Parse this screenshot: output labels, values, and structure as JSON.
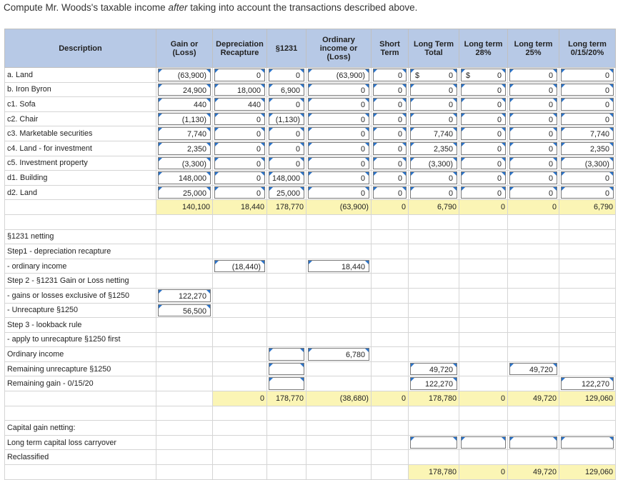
{
  "prompt": {
    "before": "Compute Mr. Woods's taxable income ",
    "emph": "after",
    "after": " taking into account the transactions described above."
  },
  "headers": [
    "Description",
    "Gain or (Loss)",
    "Depreciation Recapture",
    "§1231",
    "Ordinary income or (Loss)",
    "Short Term",
    "Long Term Total",
    "Long term 28%",
    "Long term 25%",
    "Long term 0/15/20%"
  ],
  "rows": [
    {
      "label": "a. Land",
      "cells": [
        {
          "t": "i",
          "v": "(63,900)"
        },
        {
          "t": "i",
          "v": "0"
        },
        {
          "t": "i",
          "v": "0"
        },
        {
          "t": "i",
          "v": "(63,900)"
        },
        {
          "t": "i",
          "v": "0"
        },
        {
          "t": "i",
          "v": "0",
          "c": "$"
        },
        {
          "t": "i",
          "v": "0",
          "c": "$"
        },
        {
          "t": "i",
          "v": "0"
        },
        {
          "t": "i",
          "v": "0"
        }
      ]
    },
    {
      "label": "b. Iron Byron",
      "cells": [
        {
          "t": "i",
          "v": "24,900"
        },
        {
          "t": "i",
          "v": "18,000"
        },
        {
          "t": "i",
          "v": "6,900"
        },
        {
          "t": "i",
          "v": "0"
        },
        {
          "t": "i",
          "v": "0"
        },
        {
          "t": "i",
          "v": "0"
        },
        {
          "t": "i",
          "v": "0"
        },
        {
          "t": "i",
          "v": "0"
        },
        {
          "t": "i",
          "v": "0"
        }
      ]
    },
    {
      "label": "c1. Sofa",
      "cells": [
        {
          "t": "i",
          "v": "440"
        },
        {
          "t": "i",
          "v": "440"
        },
        {
          "t": "i",
          "v": "0"
        },
        {
          "t": "i",
          "v": "0"
        },
        {
          "t": "i",
          "v": "0"
        },
        {
          "t": "i",
          "v": "0"
        },
        {
          "t": "i",
          "v": "0"
        },
        {
          "t": "i",
          "v": "0"
        },
        {
          "t": "i",
          "v": "0"
        }
      ]
    },
    {
      "label": "c2. Chair",
      "cells": [
        {
          "t": "i",
          "v": "(1,130)"
        },
        {
          "t": "i",
          "v": "0"
        },
        {
          "t": "i",
          "v": "(1,130)"
        },
        {
          "t": "i",
          "v": "0"
        },
        {
          "t": "i",
          "v": "0"
        },
        {
          "t": "i",
          "v": "0"
        },
        {
          "t": "i",
          "v": "0"
        },
        {
          "t": "i",
          "v": "0"
        },
        {
          "t": "i",
          "v": "0"
        }
      ]
    },
    {
      "label": "c3. Marketable securities",
      "cells": [
        {
          "t": "i",
          "v": "7,740"
        },
        {
          "t": "i",
          "v": "0"
        },
        {
          "t": "i",
          "v": "0"
        },
        {
          "t": "i",
          "v": "0"
        },
        {
          "t": "i",
          "v": "0"
        },
        {
          "t": "i",
          "v": "7,740"
        },
        {
          "t": "i",
          "v": "0"
        },
        {
          "t": "i",
          "v": "0"
        },
        {
          "t": "i",
          "v": "7,740"
        }
      ]
    },
    {
      "label": "c4. Land - for investment",
      "cells": [
        {
          "t": "i",
          "v": "2,350"
        },
        {
          "t": "i",
          "v": "0"
        },
        {
          "t": "i",
          "v": "0"
        },
        {
          "t": "i",
          "v": "0"
        },
        {
          "t": "i",
          "v": "0"
        },
        {
          "t": "i",
          "v": "2,350"
        },
        {
          "t": "i",
          "v": "0"
        },
        {
          "t": "i",
          "v": "0"
        },
        {
          "t": "i",
          "v": "2,350"
        }
      ]
    },
    {
      "label": "c5. Investment property",
      "cells": [
        {
          "t": "i",
          "v": "(3,300)"
        },
        {
          "t": "i",
          "v": "0"
        },
        {
          "t": "i",
          "v": "0"
        },
        {
          "t": "i",
          "v": "0"
        },
        {
          "t": "i",
          "v": "0"
        },
        {
          "t": "i",
          "v": "(3,300)"
        },
        {
          "t": "i",
          "v": "0"
        },
        {
          "t": "i",
          "v": "0"
        },
        {
          "t": "i",
          "v": "(3,300)"
        }
      ]
    },
    {
      "label": "d1. Building",
      "cells": [
        {
          "t": "i",
          "v": "148,000"
        },
        {
          "t": "i",
          "v": "0"
        },
        {
          "t": "i",
          "v": "148,000"
        },
        {
          "t": "i",
          "v": "0"
        },
        {
          "t": "i",
          "v": "0"
        },
        {
          "t": "i",
          "v": "0"
        },
        {
          "t": "i",
          "v": "0"
        },
        {
          "t": "i",
          "v": "0"
        },
        {
          "t": "i",
          "v": "0"
        }
      ]
    },
    {
      "label": "d2. Land",
      "cells": [
        {
          "t": "i",
          "v": "25,000"
        },
        {
          "t": "i",
          "v": "0"
        },
        {
          "t": "i",
          "v": "25,000"
        },
        {
          "t": "i",
          "v": "0"
        },
        {
          "t": "i",
          "v": "0"
        },
        {
          "t": "i",
          "v": "0"
        },
        {
          "t": "i",
          "v": "0"
        },
        {
          "t": "i",
          "v": "0"
        },
        {
          "t": "i",
          "v": "0"
        }
      ]
    },
    {
      "label": "",
      "cells": [
        {
          "t": "y",
          "v": "140,100"
        },
        {
          "t": "y",
          "v": "18,440"
        },
        {
          "t": "y",
          "v": "178,770"
        },
        {
          "t": "y",
          "v": "(63,900)"
        },
        {
          "t": "y",
          "v": "0"
        },
        {
          "t": "y",
          "v": "6,790"
        },
        {
          "t": "y",
          "v": "0"
        },
        {
          "t": "y",
          "v": "0"
        },
        {
          "t": "y",
          "v": "6,790"
        }
      ]
    },
    {
      "label": "",
      "cells": [
        {
          "t": "r",
          "v": ""
        },
        {
          "t": "r",
          "v": ""
        },
        {
          "t": "r",
          "v": ""
        },
        {
          "t": "r",
          "v": ""
        },
        {
          "t": "r",
          "v": ""
        },
        {
          "t": "r",
          "v": ""
        },
        {
          "t": "r",
          "v": ""
        },
        {
          "t": "r",
          "v": ""
        },
        {
          "t": "r",
          "v": ""
        }
      ]
    },
    {
      "label": "§1231 netting",
      "cells": [
        {
          "t": "r",
          "v": ""
        },
        {
          "t": "r",
          "v": ""
        },
        {
          "t": "r",
          "v": ""
        },
        {
          "t": "r",
          "v": ""
        },
        {
          "t": "r",
          "v": ""
        },
        {
          "t": "r",
          "v": ""
        },
        {
          "t": "r",
          "v": ""
        },
        {
          "t": "r",
          "v": ""
        },
        {
          "t": "r",
          "v": ""
        }
      ]
    },
    {
      "label": "Step1 - depreciation recapture",
      "cells": [
        {
          "t": "r",
          "v": ""
        },
        {
          "t": "r",
          "v": ""
        },
        {
          "t": "r",
          "v": ""
        },
        {
          "t": "r",
          "v": ""
        },
        {
          "t": "r",
          "v": ""
        },
        {
          "t": "r",
          "v": ""
        },
        {
          "t": "r",
          "v": ""
        },
        {
          "t": "r",
          "v": ""
        },
        {
          "t": "r",
          "v": ""
        }
      ]
    },
    {
      "label": "- ordinary income",
      "cells": [
        {
          "t": "r",
          "v": ""
        },
        {
          "t": "i",
          "v": "(18,440)"
        },
        {
          "t": "r",
          "v": ""
        },
        {
          "t": "i",
          "v": "18,440"
        },
        {
          "t": "r",
          "v": ""
        },
        {
          "t": "r",
          "v": ""
        },
        {
          "t": "r",
          "v": ""
        },
        {
          "t": "r",
          "v": ""
        },
        {
          "t": "r",
          "v": ""
        }
      ]
    },
    {
      "label": "Step 2 - §1231 Gain or Loss netting",
      "cells": [
        {
          "t": "r",
          "v": ""
        },
        {
          "t": "r",
          "v": ""
        },
        {
          "t": "r",
          "v": ""
        },
        {
          "t": "r",
          "v": ""
        },
        {
          "t": "r",
          "v": ""
        },
        {
          "t": "r",
          "v": ""
        },
        {
          "t": "r",
          "v": ""
        },
        {
          "t": "r",
          "v": ""
        },
        {
          "t": "r",
          "v": ""
        }
      ]
    },
    {
      "label": "- gains or losses exclusive of §1250",
      "cells": [
        {
          "t": "i",
          "v": "122,270"
        },
        {
          "t": "r",
          "v": ""
        },
        {
          "t": "r",
          "v": ""
        },
        {
          "t": "r",
          "v": ""
        },
        {
          "t": "r",
          "v": ""
        },
        {
          "t": "r",
          "v": ""
        },
        {
          "t": "r",
          "v": ""
        },
        {
          "t": "r",
          "v": ""
        },
        {
          "t": "r",
          "v": ""
        }
      ]
    },
    {
      "label": "- Unrecapture §1250",
      "cells": [
        {
          "t": "i",
          "v": "56,500"
        },
        {
          "t": "r",
          "v": ""
        },
        {
          "t": "r",
          "v": ""
        },
        {
          "t": "r",
          "v": ""
        },
        {
          "t": "r",
          "v": ""
        },
        {
          "t": "r",
          "v": ""
        },
        {
          "t": "r",
          "v": ""
        },
        {
          "t": "r",
          "v": ""
        },
        {
          "t": "r",
          "v": ""
        }
      ]
    },
    {
      "label": "Step 3 - lookback rule",
      "cells": [
        {
          "t": "r",
          "v": ""
        },
        {
          "t": "r",
          "v": ""
        },
        {
          "t": "r",
          "v": ""
        },
        {
          "t": "r",
          "v": ""
        },
        {
          "t": "r",
          "v": ""
        },
        {
          "t": "r",
          "v": ""
        },
        {
          "t": "r",
          "v": ""
        },
        {
          "t": "r",
          "v": ""
        },
        {
          "t": "r",
          "v": ""
        }
      ]
    },
    {
      "label": "- apply to unrecapture §1250 first",
      "cells": [
        {
          "t": "r",
          "v": ""
        },
        {
          "t": "r",
          "v": ""
        },
        {
          "t": "r",
          "v": ""
        },
        {
          "t": "r",
          "v": ""
        },
        {
          "t": "r",
          "v": ""
        },
        {
          "t": "r",
          "v": ""
        },
        {
          "t": "r",
          "v": ""
        },
        {
          "t": "r",
          "v": ""
        },
        {
          "t": "r",
          "v": ""
        }
      ]
    },
    {
      "label": "Ordinary income",
      "cells": [
        {
          "t": "r",
          "v": ""
        },
        {
          "t": "r",
          "v": ""
        },
        {
          "t": "i",
          "v": ""
        },
        {
          "t": "i",
          "v": "6,780"
        },
        {
          "t": "r",
          "v": ""
        },
        {
          "t": "r",
          "v": ""
        },
        {
          "t": "r",
          "v": ""
        },
        {
          "t": "r",
          "v": ""
        },
        {
          "t": "r",
          "v": ""
        }
      ]
    },
    {
      "label": "Remaining unrecapture §1250",
      "cells": [
        {
          "t": "r",
          "v": ""
        },
        {
          "t": "r",
          "v": ""
        },
        {
          "t": "i",
          "v": ""
        },
        {
          "t": "r",
          "v": ""
        },
        {
          "t": "r",
          "v": ""
        },
        {
          "t": "i",
          "v": "49,720"
        },
        {
          "t": "r",
          "v": ""
        },
        {
          "t": "i",
          "v": "49,720"
        },
        {
          "t": "r",
          "v": ""
        }
      ]
    },
    {
      "label": "Remaining gain - 0/15/20",
      "cells": [
        {
          "t": "r",
          "v": ""
        },
        {
          "t": "r",
          "v": ""
        },
        {
          "t": "i",
          "v": ""
        },
        {
          "t": "r",
          "v": ""
        },
        {
          "t": "r",
          "v": ""
        },
        {
          "t": "i",
          "v": "122,270"
        },
        {
          "t": "r",
          "v": ""
        },
        {
          "t": "r",
          "v": ""
        },
        {
          "t": "i",
          "v": "122,270"
        }
      ]
    },
    {
      "label": "",
      "cells": [
        {
          "t": "r",
          "v": ""
        },
        {
          "t": "y",
          "v": "0"
        },
        {
          "t": "y",
          "v": "178,770"
        },
        {
          "t": "y",
          "v": "(38,680)"
        },
        {
          "t": "y",
          "v": "0"
        },
        {
          "t": "y",
          "v": "178,780"
        },
        {
          "t": "y",
          "v": "0"
        },
        {
          "t": "y",
          "v": "49,720"
        },
        {
          "t": "y",
          "v": "129,060"
        }
      ]
    },
    {
      "label": "",
      "cells": [
        {
          "t": "r",
          "v": ""
        },
        {
          "t": "r",
          "v": ""
        },
        {
          "t": "r",
          "v": ""
        },
        {
          "t": "r",
          "v": ""
        },
        {
          "t": "r",
          "v": ""
        },
        {
          "t": "r",
          "v": ""
        },
        {
          "t": "r",
          "v": ""
        },
        {
          "t": "r",
          "v": ""
        },
        {
          "t": "r",
          "v": ""
        }
      ]
    },
    {
      "label": "Capital gain netting:",
      "cells": [
        {
          "t": "r",
          "v": ""
        },
        {
          "t": "r",
          "v": ""
        },
        {
          "t": "r",
          "v": ""
        },
        {
          "t": "r",
          "v": ""
        },
        {
          "t": "r",
          "v": ""
        },
        {
          "t": "r",
          "v": ""
        },
        {
          "t": "r",
          "v": ""
        },
        {
          "t": "r",
          "v": ""
        },
        {
          "t": "r",
          "v": ""
        }
      ]
    },
    {
      "label": "Long term capital loss carryover",
      "cells": [
        {
          "t": "r",
          "v": ""
        },
        {
          "t": "r",
          "v": ""
        },
        {
          "t": "r",
          "v": ""
        },
        {
          "t": "r",
          "v": ""
        },
        {
          "t": "r",
          "v": ""
        },
        {
          "t": "i",
          "v": ""
        },
        {
          "t": "i",
          "v": ""
        },
        {
          "t": "i",
          "v": ""
        },
        {
          "t": "i",
          "v": ""
        }
      ]
    },
    {
      "label": "Reclassified",
      "cells": [
        {
          "t": "r",
          "v": ""
        },
        {
          "t": "r",
          "v": ""
        },
        {
          "t": "r",
          "v": ""
        },
        {
          "t": "r",
          "v": ""
        },
        {
          "t": "r",
          "v": ""
        },
        {
          "t": "r",
          "v": ""
        },
        {
          "t": "r",
          "v": ""
        },
        {
          "t": "r",
          "v": ""
        },
        {
          "t": "r",
          "v": ""
        }
      ]
    },
    {
      "label": "",
      "cells": [
        {
          "t": "r",
          "v": ""
        },
        {
          "t": "r",
          "v": ""
        },
        {
          "t": "r",
          "v": ""
        },
        {
          "t": "r",
          "v": ""
        },
        {
          "t": "r",
          "v": ""
        },
        {
          "t": "y",
          "v": "178,780"
        },
        {
          "t": "y",
          "v": "0"
        },
        {
          "t": "y",
          "v": "49,720"
        },
        {
          "t": "y",
          "v": "129,060"
        }
      ]
    }
  ]
}
